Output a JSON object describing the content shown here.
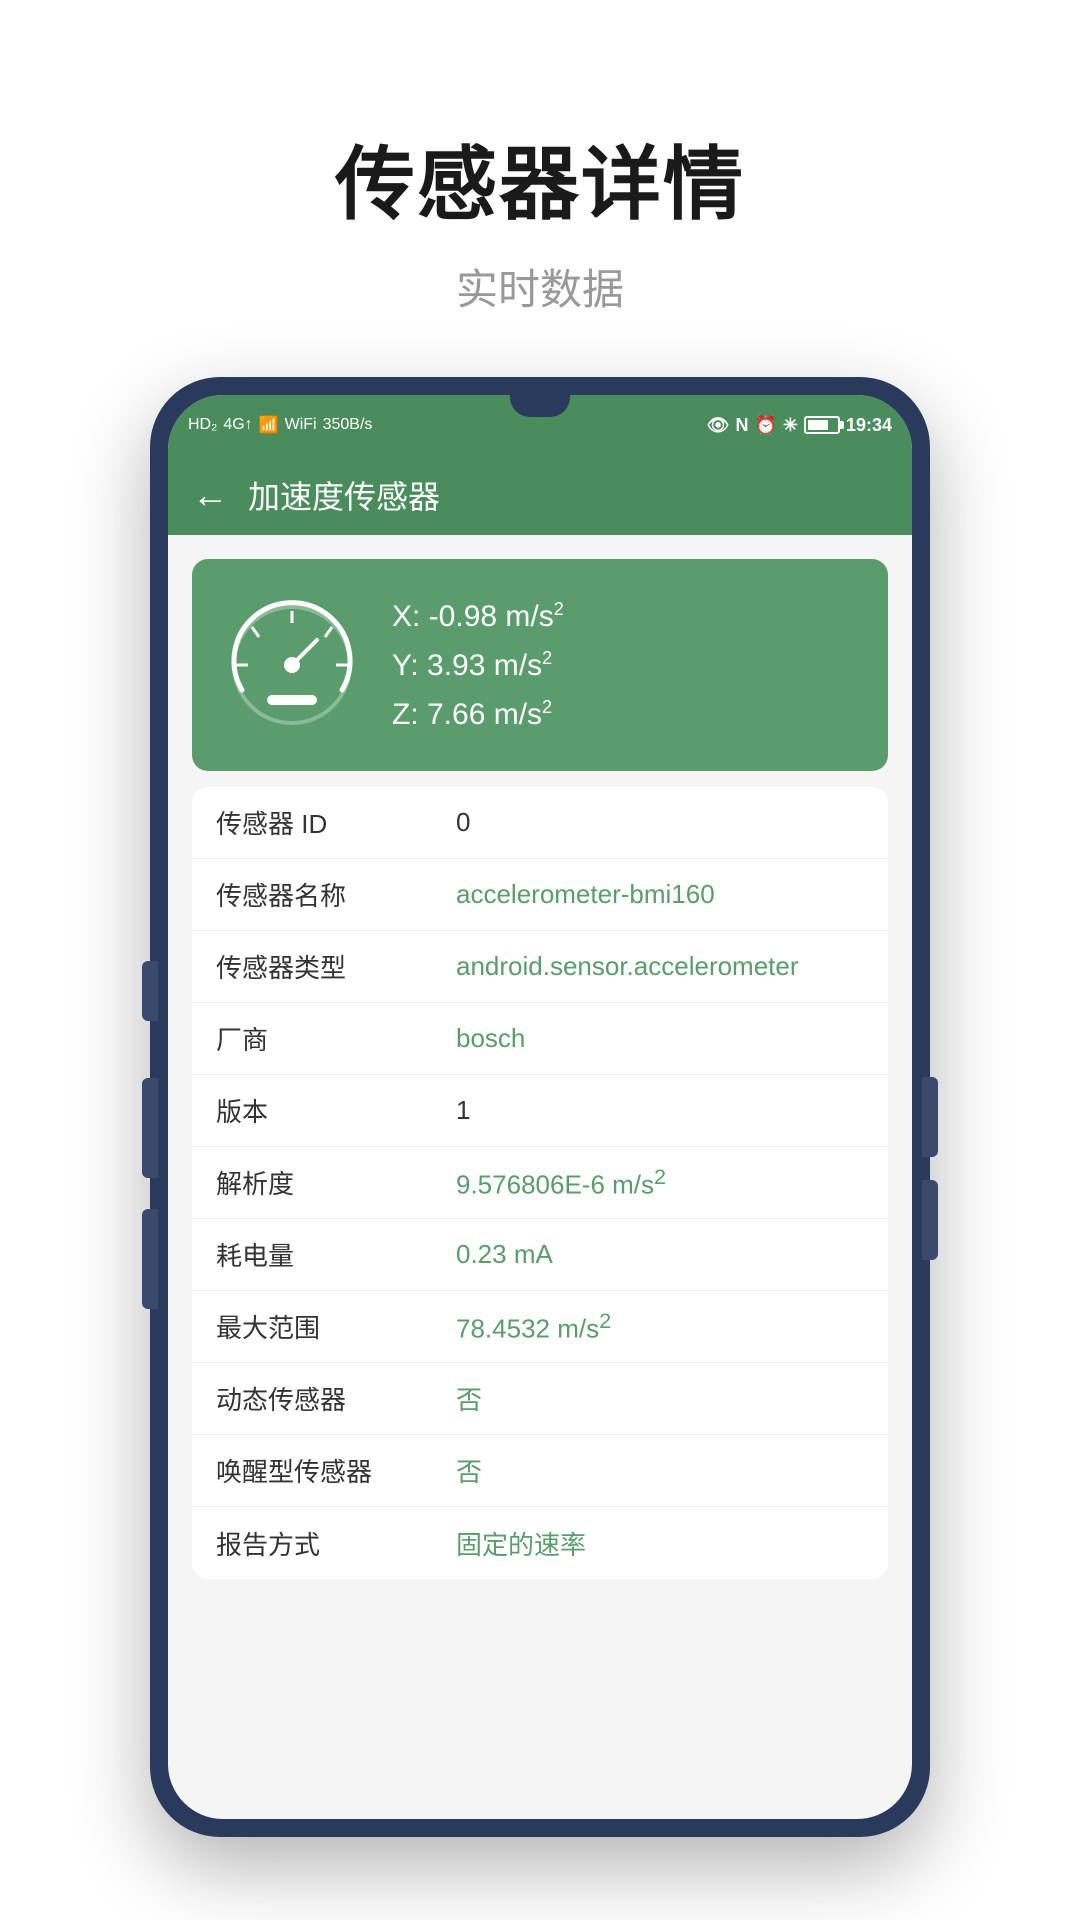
{
  "header": {
    "title": "传感器详情",
    "subtitle": "实时数据"
  },
  "statusBar": {
    "left": "HD₂ 4G↑ 4G↑",
    "speed": "350B/s",
    "time": "19:34",
    "battery": "54"
  },
  "appBar": {
    "back": "←",
    "title": "加速度传感器"
  },
  "sensorReadings": {
    "x": "X: -0.98 m/s²",
    "y": "Y: 3.93 m/s²",
    "z": "Z: 7.66 m/s²"
  },
  "details": [
    {
      "label": "传感器 ID",
      "value": "0",
      "black": true
    },
    {
      "label": "传感器名称",
      "value": "accelerometer-bmi160",
      "black": false
    },
    {
      "label": "传感器类型",
      "value": "android.sensor.accelerometer",
      "black": false
    },
    {
      "label": "厂商",
      "value": "bosch",
      "black": false
    },
    {
      "label": "版本",
      "value": "1",
      "black": true
    },
    {
      "label": "解析度",
      "value": "9.576806E-6 m/s²",
      "black": false
    },
    {
      "label": "耗电量",
      "value": "0.23  mA",
      "black": false
    },
    {
      "label": "最大范围",
      "value": "78.4532 m/s²",
      "black": false
    },
    {
      "label": "动态传感器",
      "value": "否",
      "black": false
    },
    {
      "label": "唤醒型传感器",
      "value": "否",
      "black": false
    },
    {
      "label": "报告方式",
      "value": "固定的速率",
      "black": false
    }
  ]
}
